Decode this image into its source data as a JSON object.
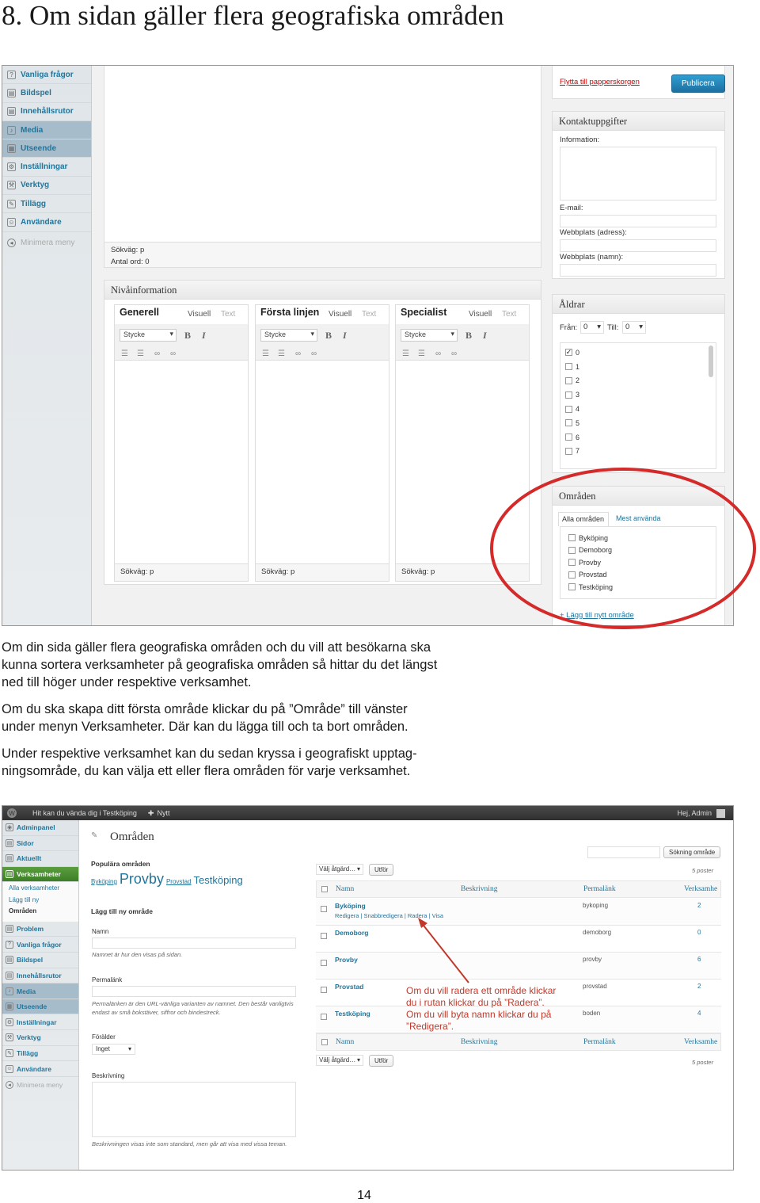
{
  "page": {
    "heading": "8. Om sidan gäller flera geografiska områden",
    "paragraphs": [
      [
        "Om din sida gäller flera geografiska områden och du vill att besökarna ska",
        "kunna sortera verksamheter på geografiska områden så hittar du det längst",
        "ned till höger under respektive verksamhet."
      ],
      [
        "Om du ska skapa ditt första område klickar du på ”Område” till vänster",
        "under menyn Verksamheter. Där kan du lägga till och ta bort områden."
      ],
      [
        "Under respektive verksamhet kan du sedan kryssa i geografiskt upptag-",
        "ningsområde, du kan välja ett eller flera områden för varje verksamhet."
      ]
    ],
    "page_number": "14"
  },
  "shot1": {
    "sidebar": [
      {
        "label": "Vanliga frågor",
        "icon": "help-icon",
        "glyph": "?"
      },
      {
        "label": "Bildspel",
        "icon": "slideshow-icon",
        "glyph": "▤"
      },
      {
        "label": "Innehållsrutor",
        "icon": "content-box-icon",
        "glyph": "▤"
      },
      {
        "label": "Media",
        "icon": "media-icon",
        "glyph": "♪",
        "highlight": true
      },
      {
        "label": "Utseende",
        "icon": "appearance-icon",
        "glyph": "▦",
        "highlight": true
      },
      {
        "label": "Inställningar",
        "icon": "settings-icon",
        "glyph": "⚙"
      },
      {
        "label": "Verktyg",
        "icon": "tools-icon",
        "glyph": "⚒"
      },
      {
        "label": "Tillägg",
        "icon": "plugin-icon",
        "glyph": "✎"
      },
      {
        "label": "Användare",
        "icon": "users-icon",
        "glyph": "☺"
      }
    ],
    "minimize_menu": "Minimera meny",
    "editor_status": {
      "path": "Sökväg: p",
      "word_count": "Antal ord: 0"
    },
    "level_info": {
      "title": "Nivåinformation",
      "columns": [
        {
          "title": "Generell",
          "visual": "Visuell",
          "text": "Text",
          "format": "Stycke",
          "path": "Sökväg: p"
        },
        {
          "title": "Första linjen",
          "visual": "Visuell",
          "text": "Text",
          "format": "Stycke",
          "path": "Sökväg: p"
        },
        {
          "title": "Specialist",
          "visual": "Visuell",
          "text": "Text",
          "format": "Stycke",
          "path": "Sökväg: p"
        }
      ]
    },
    "publish": {
      "trash": "Flytta till papperskorgen",
      "publish": "Publicera"
    },
    "contact": {
      "title": "Kontaktuppgifter",
      "information": "Information:",
      "email": "E-mail:",
      "website_address": "Webbplats (adress):",
      "website_name": "Webbplats (namn):"
    },
    "ages": {
      "title": "Åldrar",
      "from_label": "Från:",
      "from_value": "0",
      "to_label": "Till:",
      "to_value": "0",
      "options": [
        {
          "label": "0",
          "checked": true
        },
        {
          "label": "1",
          "checked": false
        },
        {
          "label": "2",
          "checked": false
        },
        {
          "label": "3",
          "checked": false
        },
        {
          "label": "4",
          "checked": false
        },
        {
          "label": "5",
          "checked": false
        },
        {
          "label": "6",
          "checked": false
        },
        {
          "label": "7",
          "checked": false
        }
      ]
    },
    "areas": {
      "title": "Områden",
      "tab_all": "Alla områden",
      "tab_most_used": "Mest använda",
      "options": [
        "Byköping",
        "Demoborg",
        "Provby",
        "Provstad",
        "Testköping"
      ],
      "add_link": "+ Lägg till nytt område"
    },
    "highlight_color": "#d42a2a"
  },
  "shot2": {
    "admin_bar": {
      "site": "Hit kan du vända dig i Testköping",
      "new": "Nytt",
      "greeting": "Hej, Admin"
    },
    "sidebar": [
      {
        "label": "Adminpanel",
        "icon": "dashboard-icon",
        "glyph": "◉"
      },
      {
        "label": "Sidor",
        "icon": "pages-icon",
        "glyph": "▤"
      },
      {
        "label": "Aktuellt",
        "icon": "news-icon",
        "glyph": "▤"
      },
      {
        "label": "Verksamheter",
        "icon": "business-icon",
        "glyph": "▤",
        "active": true
      }
    ],
    "submenu": [
      "Alla verksamheter",
      "Lägg till ny",
      "Områden"
    ],
    "sidebar_rest": [
      {
        "label": "Problem",
        "icon": "problem-icon",
        "glyph": "▤"
      },
      {
        "label": "Vanliga frågor",
        "icon": "help-icon",
        "glyph": "?"
      },
      {
        "label": "Bildspel",
        "icon": "slideshow-icon",
        "glyph": "▤"
      },
      {
        "label": "Innehållsrutor",
        "icon": "content-box-icon",
        "glyph": "▤"
      },
      {
        "label": "Media",
        "icon": "media-icon",
        "glyph": "♪",
        "highlight": true
      },
      {
        "label": "Utseende",
        "icon": "appearance-icon",
        "glyph": "▦",
        "highlight": true
      },
      {
        "label": "Inställningar",
        "icon": "settings-icon",
        "glyph": "⚙"
      },
      {
        "label": "Verktyg",
        "icon": "tools-icon",
        "glyph": "⚒"
      },
      {
        "label": "Tillägg",
        "icon": "plugin-icon",
        "glyph": "✎"
      },
      {
        "label": "Användare",
        "icon": "users-icon",
        "glyph": "☺"
      }
    ],
    "minimize_menu": "Minimera meny",
    "page_title": "Områden",
    "search_button": "Sökning område",
    "popular_title": "Populära områden",
    "popular_tags": [
      {
        "label": "Byköping",
        "size": 7
      },
      {
        "label": "Provby",
        "size": 17
      },
      {
        "label": "Provstad",
        "size": 7
      },
      {
        "label": "Testköping",
        "size": 12
      }
    ],
    "add_title": "Lägg till ny område",
    "name_label": "Namn",
    "name_help": "Namnet är hur den visas på sidan.",
    "slug_label": "Permalänk",
    "slug_help": "Permalänken är den URL-vänliga varianten av namnet. Den består vanligtvis endast av små bokstäver, siffror och bindestreck.",
    "parent_label": "Förälder",
    "parent_value": "Inget",
    "desc_label": "Beskrivning",
    "desc_help": "Beskrivningen visas inte som standard, men går att visa med vissa teman.",
    "bulk_action": "Välj åtgärd…",
    "apply": "Utför",
    "count": "5 poster",
    "columns": [
      "Namn",
      "Beskrivning",
      "Permalänk",
      "Verksamhe"
    ],
    "rows": [
      {
        "name": "Byköping",
        "slug": "bykoping",
        "count": "2",
        "actions": "Redigera | Snabbredigera | Radera | Visa"
      },
      {
        "name": "Demoborg",
        "slug": "demoborg",
        "count": "0",
        "actions": ""
      },
      {
        "name": "Provby",
        "slug": "provby",
        "count": "6",
        "actions": ""
      },
      {
        "name": "Provstad",
        "slug": "provstad",
        "count": "2",
        "actions": ""
      },
      {
        "name": "Testköping",
        "slug": "boden",
        "count": "4",
        "actions": ""
      }
    ],
    "note": [
      "Om du vill radera ett område klickar",
      "du i rutan klickar du på ”Radera”.",
      "Om du vill byta namn klickar du på",
      "”Redigera”."
    ]
  }
}
